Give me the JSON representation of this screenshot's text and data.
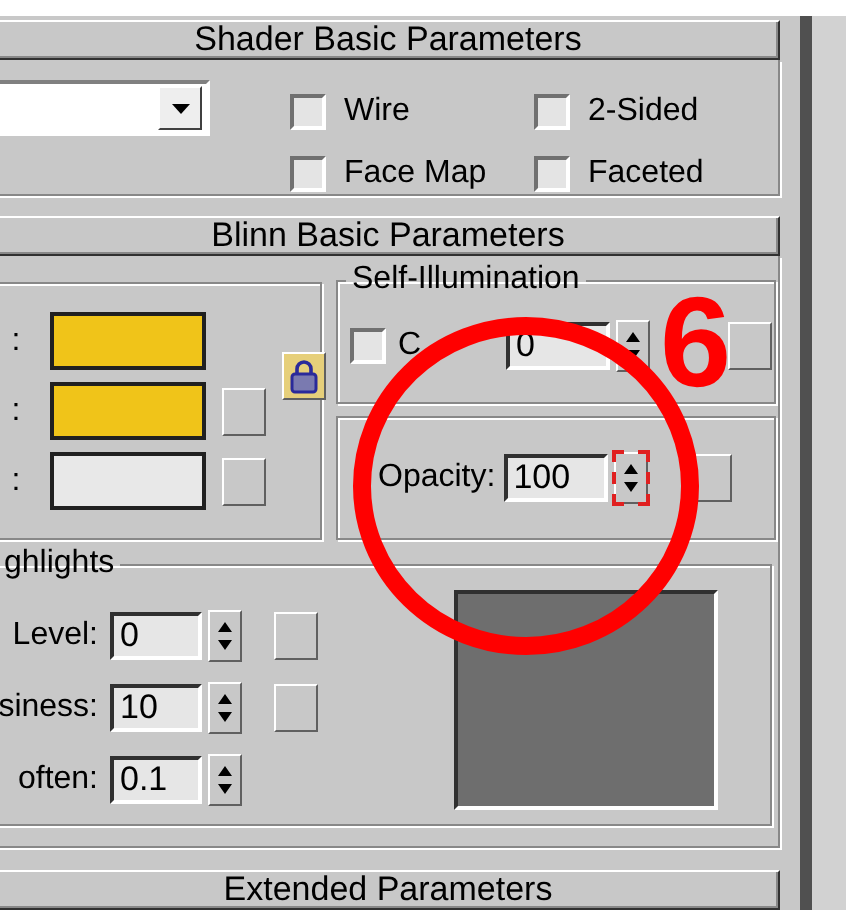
{
  "shader_basic": {
    "title": "Shader Basic Parameters",
    "checkboxes": [
      {
        "label": "Wire",
        "checked": false
      },
      {
        "label": "2-Sided",
        "checked": false
      },
      {
        "label": "Face Map",
        "checked": false
      },
      {
        "label": "Faceted",
        "checked": false
      }
    ]
  },
  "blinn_basic": {
    "title": "Blinn Basic Parameters",
    "colors": [
      {
        "label": ":",
        "color": "#f0c419",
        "map_button": false
      },
      {
        "label": ":",
        "color": "#f0c419",
        "map_button": true
      },
      {
        "label": ":",
        "color": "#e8e8e8",
        "map_button": true
      }
    ],
    "self_illumination": {
      "title": "Self-Illumination",
      "checkbox": {
        "label": "C",
        "checked": false
      },
      "spinner": {
        "value": "0",
        "highlighted": false
      }
    },
    "opacity": {
      "label": "Opacity:",
      "spinner": {
        "value": "100",
        "highlighted": true
      }
    },
    "highlights": {
      "title": "ghlights",
      "rows": [
        {
          "label": "Level:",
          "spinner": {
            "value": "0",
            "highlighted": false
          },
          "map_button": true
        },
        {
          "label": "siness:",
          "spinner": {
            "value": "10",
            "highlighted": false
          },
          "map_button": true
        },
        {
          "label": "often:",
          "spinner": {
            "value": "0.1",
            "highlighted": false
          },
          "map_button": false
        }
      ]
    }
  },
  "extended": {
    "title": "Extended Parameters"
  },
  "annotation": {
    "label": "6"
  }
}
